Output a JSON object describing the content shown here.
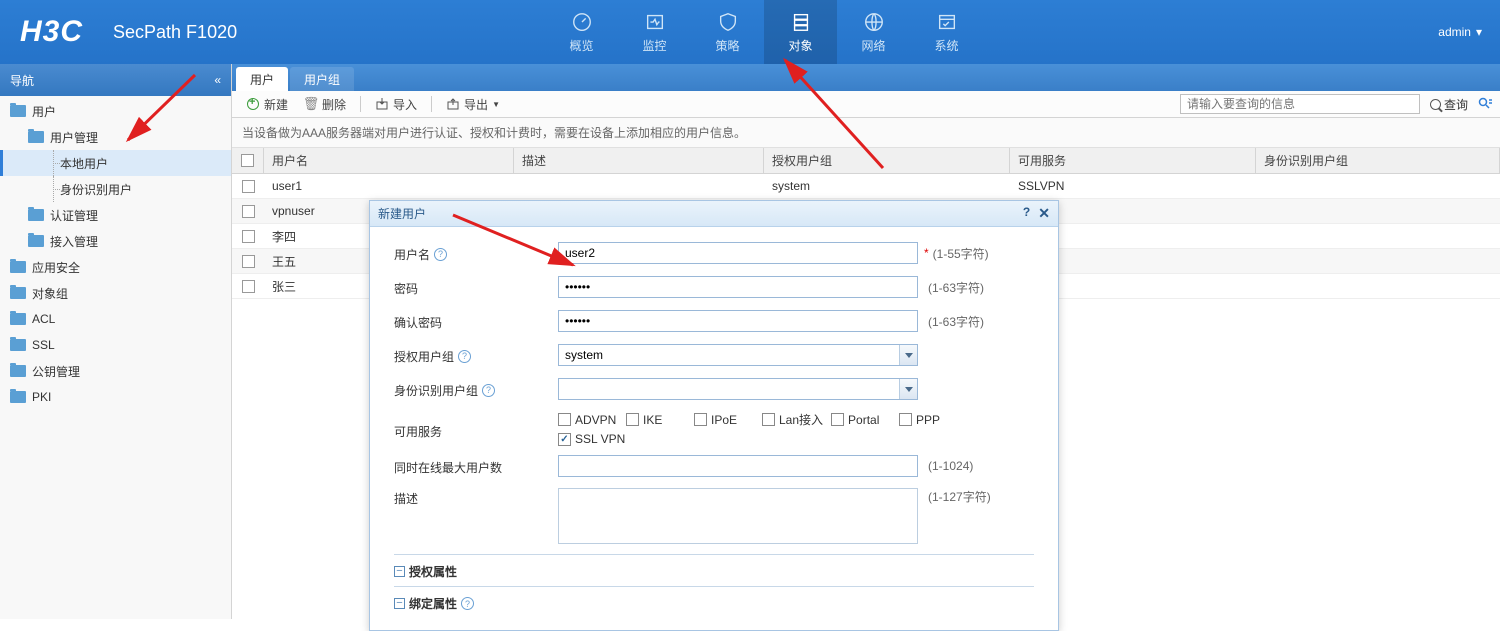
{
  "header": {
    "logo": "H3C",
    "product": "SecPath F1020",
    "user": "admin",
    "nav": [
      {
        "label": "概览"
      },
      {
        "label": "监控"
      },
      {
        "label": "策略"
      },
      {
        "label": "对象"
      },
      {
        "label": "网络"
      },
      {
        "label": "系统"
      }
    ]
  },
  "sidebar": {
    "title": "导航",
    "items": {
      "users": "用户",
      "user_mgmt": "用户管理",
      "local_user": "本地用户",
      "id_user": "身份识别用户",
      "auth_mgmt": "认证管理",
      "access_mgmt": "接入管理",
      "app_sec": "应用安全",
      "obj_group": "对象组",
      "acl": "ACL",
      "ssl": "SSL",
      "pubkey": "公钥管理",
      "pki": "PKI"
    }
  },
  "tabs": {
    "user": "用户",
    "user_group": "用户组"
  },
  "toolbar": {
    "new": "新建",
    "delete": "删除",
    "import": "导入",
    "export": "导出",
    "search_placeholder": "请输入要查询的信息",
    "search_btn": "查询"
  },
  "desc": "当设备做为AAA服务器端对用户进行认证、授权和计费时，需要在设备上添加相应的用户信息。",
  "columns": {
    "name": "用户名",
    "desc": "描述",
    "group": "授权用户组",
    "svc": "可用服务",
    "id": "身份识别用户组"
  },
  "rows": [
    {
      "name": "user1",
      "desc": "",
      "group": "system",
      "svc": "SSLVPN"
    },
    {
      "name": "vpnuser",
      "desc": "",
      "group": "",
      "svc": ""
    },
    {
      "name": "李四",
      "desc": "",
      "group": "",
      "svc": ""
    },
    {
      "name": "王五",
      "desc": "",
      "group": "",
      "svc": ""
    },
    {
      "name": "张三",
      "desc": "",
      "group": "",
      "svc": ""
    }
  ],
  "dialog": {
    "title": "新建用户",
    "labels": {
      "username": "用户名",
      "password": "密码",
      "confirm": "确认密码",
      "auth_group": "授权用户组",
      "id_group": "身份识别用户组",
      "services": "可用服务",
      "max_online": "同时在线最大用户数",
      "desc": "描述"
    },
    "values": {
      "username": "user2",
      "password": "••••••",
      "confirm": "••••••",
      "auth_group": "system",
      "id_group": "",
      "max_online": "",
      "desc": ""
    },
    "hints": {
      "username": "(1-55字符)",
      "password": "(1-63字符)",
      "confirm": "(1-63字符)",
      "max_online": "(1-1024)",
      "desc": "(1-127字符)"
    },
    "services": [
      {
        "label": "ADVPN",
        "checked": false
      },
      {
        "label": "IKE",
        "checked": false
      },
      {
        "label": "IPoE",
        "checked": false
      },
      {
        "label": "Lan接入",
        "checked": false
      },
      {
        "label": "Portal",
        "checked": false
      },
      {
        "label": "PPP",
        "checked": false
      },
      {
        "label": "SSL VPN",
        "checked": true
      }
    ],
    "sections": {
      "auth_attr": "授权属性",
      "bind_attr": "绑定属性"
    }
  }
}
